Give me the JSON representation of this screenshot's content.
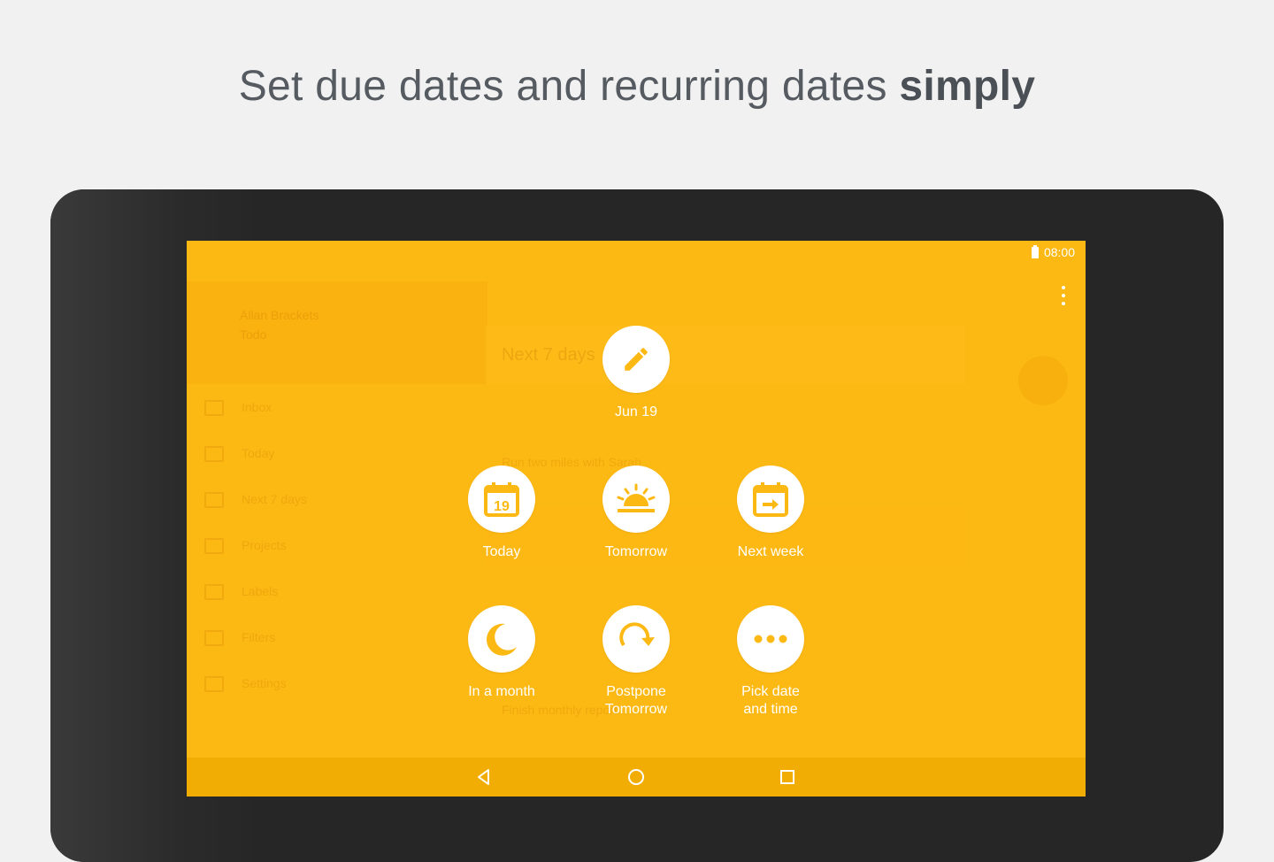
{
  "headline": {
    "regular": "Set due dates and recurring dates",
    "bold": "simply"
  },
  "status_bar": {
    "time": "08:00"
  },
  "colors": {
    "accent": "#fdb913",
    "icon": "#fdb913",
    "text": "#ffffff"
  },
  "background_app": {
    "account_name": "Allan Brackets",
    "account_sub": "Todo",
    "view_title": "Next 7 days",
    "sidebar": [
      "Inbox",
      "Today",
      "Next 7 days",
      "Projects",
      "Labels",
      "Filters",
      "Settings"
    ],
    "rows": [
      "Run two miles with Sarah",
      "Finish monthly report"
    ]
  },
  "current_date": {
    "label": "Jun 19",
    "icon": "pencil-icon"
  },
  "options": [
    {
      "label": "Today",
      "icon": "calendar-day-icon",
      "day": "19"
    },
    {
      "label": "Tomorrow",
      "icon": "sunrise-icon"
    },
    {
      "label": "Next week",
      "icon": "calendar-arrow-icon"
    },
    {
      "label": "In a month",
      "icon": "moon-icon"
    },
    {
      "label": "Postpone\nTomorrow",
      "icon": "postpone-arrow-icon"
    },
    {
      "label": "Pick date\nand time",
      "icon": "more-dots-icon"
    }
  ]
}
